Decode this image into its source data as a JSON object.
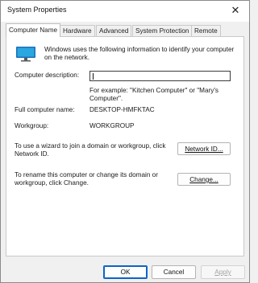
{
  "window": {
    "title": "System Properties",
    "close_glyph": "✕"
  },
  "tabs": [
    "Computer Name",
    "Hardware",
    "Advanced",
    "System Protection",
    "Remote"
  ],
  "content": {
    "intro": [
      "Windows uses the following information to identify your computer",
      "on the network."
    ],
    "description_label": "Computer description:",
    "description_value": "",
    "example": [
      "For example: \"Kitchen Computer\" or \"Mary's",
      "Computer\"."
    ],
    "full_name_label": "Full computer name:",
    "full_name_value": "DESKTOP-HMFKTAC",
    "workgroup_label": "Workgroup:",
    "workgroup_value": "WORKGROUP",
    "wizard_text": [
      "To use a wizard to join a domain or workgroup, click",
      "Network ID."
    ],
    "network_id_button": "Network ID...",
    "rename_text": [
      "To rename this computer or change its domain or",
      "workgroup, click Change."
    ],
    "change_button": "Change..."
  },
  "buttons": {
    "ok": "OK",
    "cancel": "Cancel",
    "apply": "Apply"
  },
  "icons": {
    "computer": "computer-monitor-icon",
    "close": "close-icon"
  },
  "colors": {
    "accent": "#0a64c8",
    "monitor_screen": "#2aa7e0"
  }
}
